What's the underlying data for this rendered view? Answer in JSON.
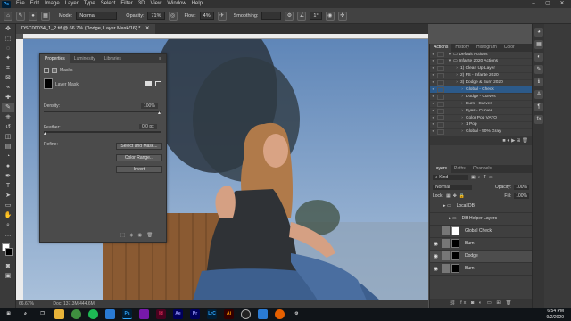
{
  "menubar": {
    "items": [
      "File",
      "Edit",
      "Image",
      "Layer",
      "Type",
      "Select",
      "Filter",
      "3D",
      "View",
      "Window",
      "Help"
    ],
    "ps": "Ps"
  },
  "options": {
    "mode_label": "Mode:",
    "mode": "Normal",
    "opacity_label": "Opacity:",
    "opacity": "71%",
    "flow_label": "Flow:",
    "flow": "4%",
    "smoothing_label": "Smoothing:",
    "angle": "1°"
  },
  "document": {
    "tab": "DSC00034_1_2.tif @ 66.7% (Dodge, Layer Mask/16) *",
    "zoom": "66.67%",
    "doc_info": "Doc: 137.3M/444.6M"
  },
  "properties": {
    "tabs": [
      "Properties",
      "Luminosity",
      "Libraries"
    ],
    "masks_label": "Masks",
    "layer_mask_label": "Layer Mask",
    "density_label": "Density:",
    "density": "100%",
    "feather_label": "Feather:",
    "feather": "0.0 px",
    "refine_label": "Refine:",
    "buttons": [
      "Select and Mask...",
      "Color Range...",
      "Invert"
    ]
  },
  "actions": {
    "tabs": [
      "Actions",
      "History",
      "Histogram",
      "Color"
    ],
    "rows": [
      {
        "label": "Default Actions",
        "selected": false
      },
      {
        "label": "Infante 2020 Actions",
        "selected": false
      },
      {
        "label": "1) Clean Up Layer",
        "selected": false
      },
      {
        "label": "2) FS - Infante 2020",
        "selected": false
      },
      {
        "label": "3) Dodge & Burn 2020",
        "selected": false
      },
      {
        "label": "Global - Check",
        "selected": true
      },
      {
        "label": "Dodge - Curves",
        "selected": false
      },
      {
        "label": "Burn - Curves",
        "selected": false
      },
      {
        "label": "Eyes - Curves",
        "selected": false
      },
      {
        "label": "Color Pop VATO",
        "selected": false
      },
      {
        "label": "1 Pop",
        "selected": false
      },
      {
        "label": "Global - 50% Gray",
        "selected": false
      }
    ]
  },
  "layers": {
    "tabs": [
      "Layers",
      "Paths",
      "Channels"
    ],
    "kind": "Kind",
    "blend_mode": "Normal",
    "opacity_label": "Opacity:",
    "opacity": "100%",
    "lock_label": "Lock:",
    "fill_label": "Fill:",
    "fill": "100%",
    "rows": [
      {
        "name": "Local DB",
        "type": "group"
      },
      {
        "name": "DB Helper Layers",
        "type": "group"
      },
      {
        "name": "Global Check",
        "type": "layer"
      },
      {
        "name": "Burn",
        "type": "layer"
      },
      {
        "name": "Dodge",
        "type": "layer"
      },
      {
        "name": "Burn",
        "type": "layer"
      }
    ]
  },
  "taskbar": {
    "apps": [
      "Ps",
      "Id",
      "Ae",
      "Pr",
      "LrC",
      "Ai"
    ],
    "time": "6:54 PM",
    "date": "9/2/2020"
  },
  "colors": {
    "ui_dark": "#323232",
    "panel": "#3f3f3f",
    "selected": "#2c5a8a",
    "sky": "#7a9cc4",
    "fence": "#8a5a32",
    "ps_blue": "#31a8ff",
    "taskbar": "#101418"
  }
}
